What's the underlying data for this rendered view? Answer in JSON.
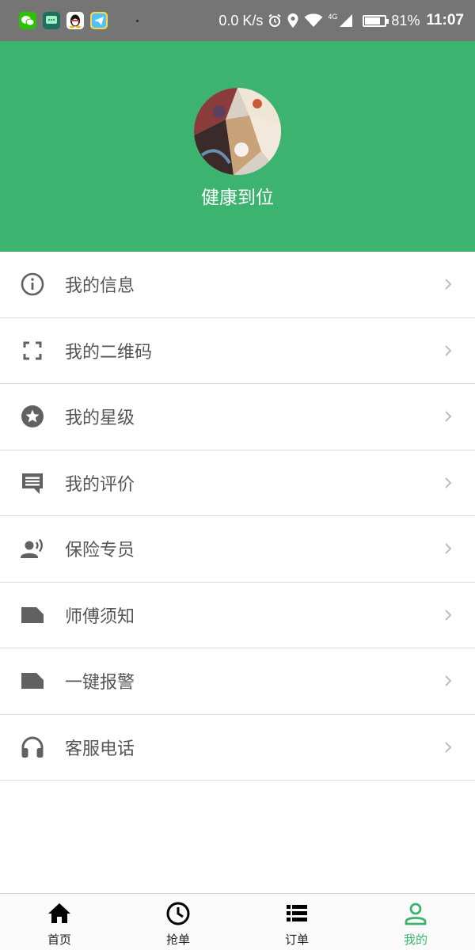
{
  "status_bar": {
    "app_icons": [
      "wechat-icon",
      "messages-icon",
      "qq-penguin-icon",
      "telegram-icon"
    ],
    "net_speed": "0.0 K/s",
    "network_type": "4G",
    "battery_percent": "81%",
    "battery_level": 0.81,
    "time": "11:07"
  },
  "header": {
    "background_color": "#3db370",
    "username": "健康到位"
  },
  "menu": {
    "items": [
      {
        "icon": "info-icon",
        "label": "我的信息"
      },
      {
        "icon": "qr-scan-icon",
        "label": "我的二维码"
      },
      {
        "icon": "star-icon",
        "label": "我的星级"
      },
      {
        "icon": "comment-icon",
        "label": "我的评价"
      },
      {
        "icon": "speaker-person-icon",
        "label": "保险专员"
      },
      {
        "icon": "label-icon",
        "label": "师傅须知"
      },
      {
        "icon": "label-icon",
        "label": "一键报警"
      },
      {
        "icon": "headphones-icon",
        "label": "客服电话"
      }
    ],
    "icon_color": "#616161"
  },
  "bottom_nav": {
    "tabs": [
      {
        "icon": "home-icon",
        "label": "首页",
        "active": false
      },
      {
        "icon": "clock-icon",
        "label": "抢单",
        "active": false
      },
      {
        "icon": "list-icon",
        "label": "订单",
        "active": false
      },
      {
        "icon": "person-icon",
        "label": "我的",
        "active": true
      }
    ],
    "active_color": "#3db370"
  }
}
